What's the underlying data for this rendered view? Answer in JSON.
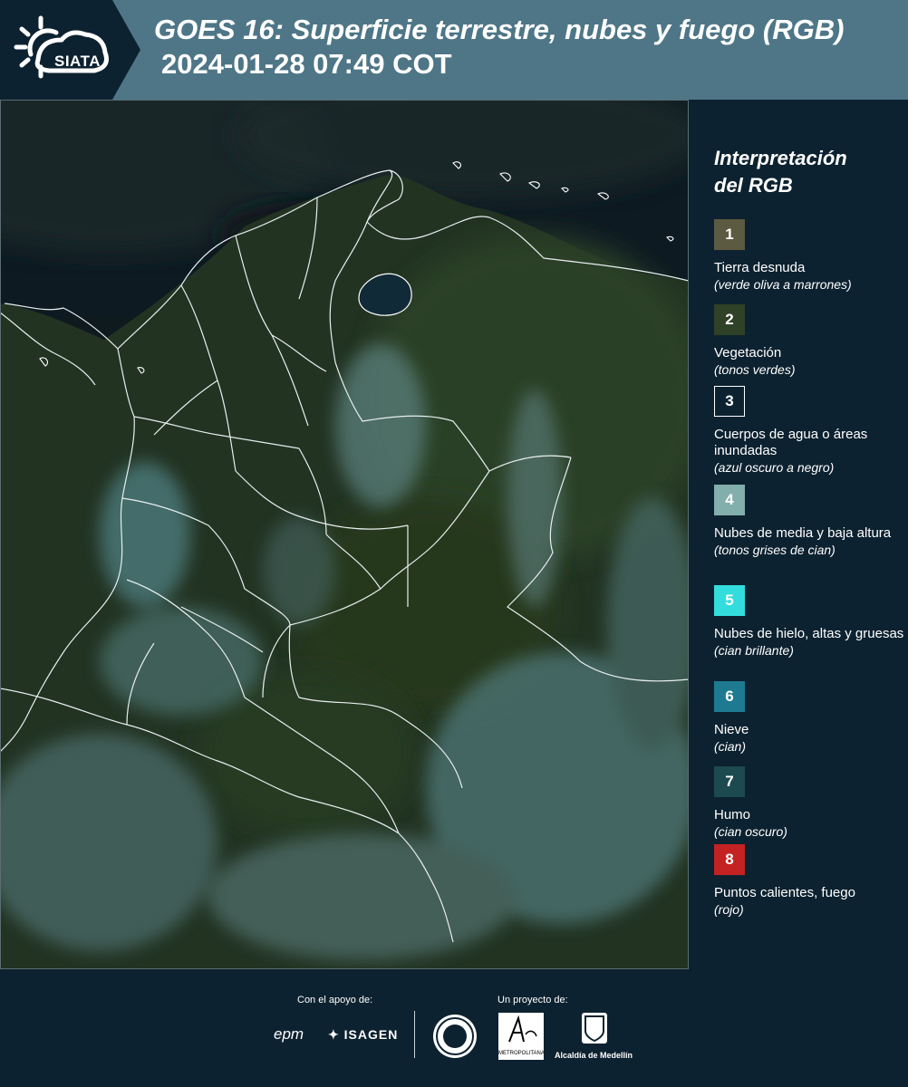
{
  "header": {
    "logo_text": "SIATA",
    "title": "GOES 16: Superficie terrestre, nubes y fuego (RGB)",
    "datetime": "2024-01-28 07:49 COT"
  },
  "legend": {
    "title_line1": "Interpretación",
    "title_line2": "del RGB",
    "items": [
      {
        "num": "1",
        "color": "#5c5a41",
        "label": "Tierra desnuda",
        "desc": "(verde oliva a marrones)"
      },
      {
        "num": "2",
        "color": "#2f4126",
        "label": "Vegetación",
        "desc": "(tonos verdes)"
      },
      {
        "num": "3",
        "color": "#0d2230",
        "label": "Cuerpos de agua o áreas inundadas",
        "desc": "(azul oscuro a negro)"
      },
      {
        "num": "4",
        "color": "#82aeac",
        "label": "Nubes de media y baja altura",
        "desc": "(tonos grises de cian)"
      },
      {
        "num": "5",
        "color": "#33dddd",
        "label": "Nubes de hielo, altas y gruesas",
        "desc": "(cian brillante)"
      },
      {
        "num": "6",
        "color": "#1e7a91",
        "label": "Nieve",
        "desc": "(cian)"
      },
      {
        "num": "7",
        "color": "#1c4a4e",
        "label": "Humo",
        "desc": "(cian oscuro)"
      },
      {
        "num": "8",
        "color": "#c42222",
        "label": "Puntos calientes, fuego",
        "desc": "(rojo)"
      }
    ]
  },
  "footer": {
    "support_label": "Con el apoyo de:",
    "project_label": "Un proyecto de:",
    "epm": "epm",
    "isagen": "ISAGEN",
    "area_text": "METROPOLITANA",
    "medellin": "Alcaldía de Medellín"
  }
}
